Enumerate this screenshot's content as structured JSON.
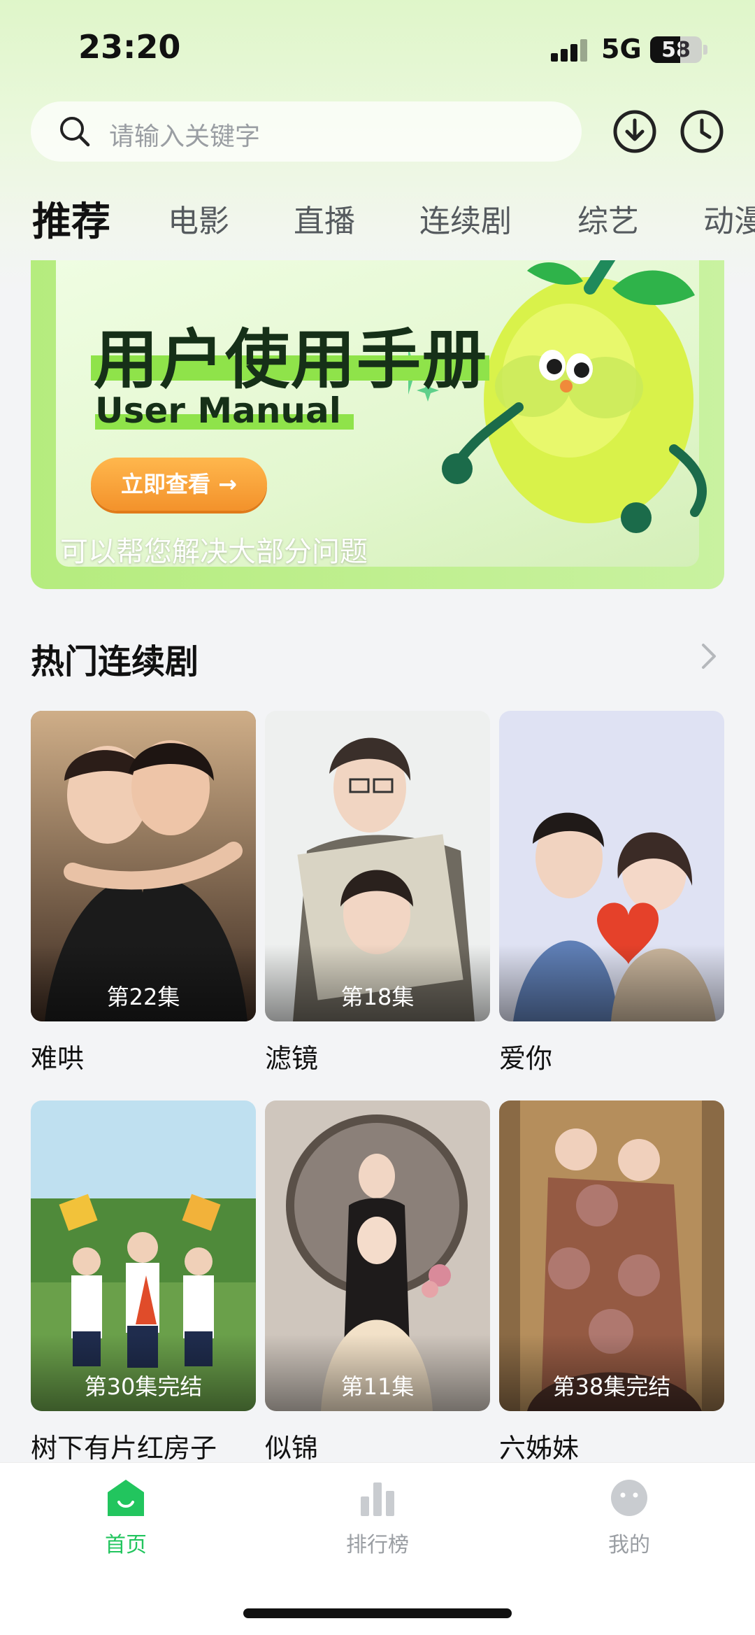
{
  "status_bar": {
    "time": "23:20",
    "network": "5G",
    "battery": "58",
    "battery_level": 0.58
  },
  "search": {
    "placeholder": "请输入关键字"
  },
  "header_icons": [
    "download-icon",
    "history-clock-icon"
  ],
  "tabs": [
    {
      "label": "推荐",
      "active": true
    },
    {
      "label": "电影"
    },
    {
      "label": "直播"
    },
    {
      "label": "连续剧"
    },
    {
      "label": "综艺"
    },
    {
      "label": "动漫"
    }
  ],
  "banner": {
    "title": "用户使用手册",
    "subtitle": "User Manual",
    "button": "立即查看 →",
    "caption": "可以帮您解决大部分问题"
  },
  "section": {
    "title": "热门连续剧"
  },
  "dramas": [
    {
      "title": "难哄",
      "episode": "第22集"
    },
    {
      "title": "滤镜",
      "episode": "第18集"
    },
    {
      "title": "爱你",
      "episode": ""
    },
    {
      "title": "树下有片红房子",
      "episode": "第30集完结"
    },
    {
      "title": "似锦",
      "episode": "第11集"
    },
    {
      "title": "六姊妹",
      "episode": "第38集完结"
    }
  ],
  "nav": [
    {
      "label": "首页",
      "active": true
    },
    {
      "label": "排行榜"
    },
    {
      "label": "我的"
    }
  ],
  "colors": {
    "accent": "#22c55e",
    "banner_green": "#b5ec7e",
    "button_orange": "#f3922b"
  }
}
